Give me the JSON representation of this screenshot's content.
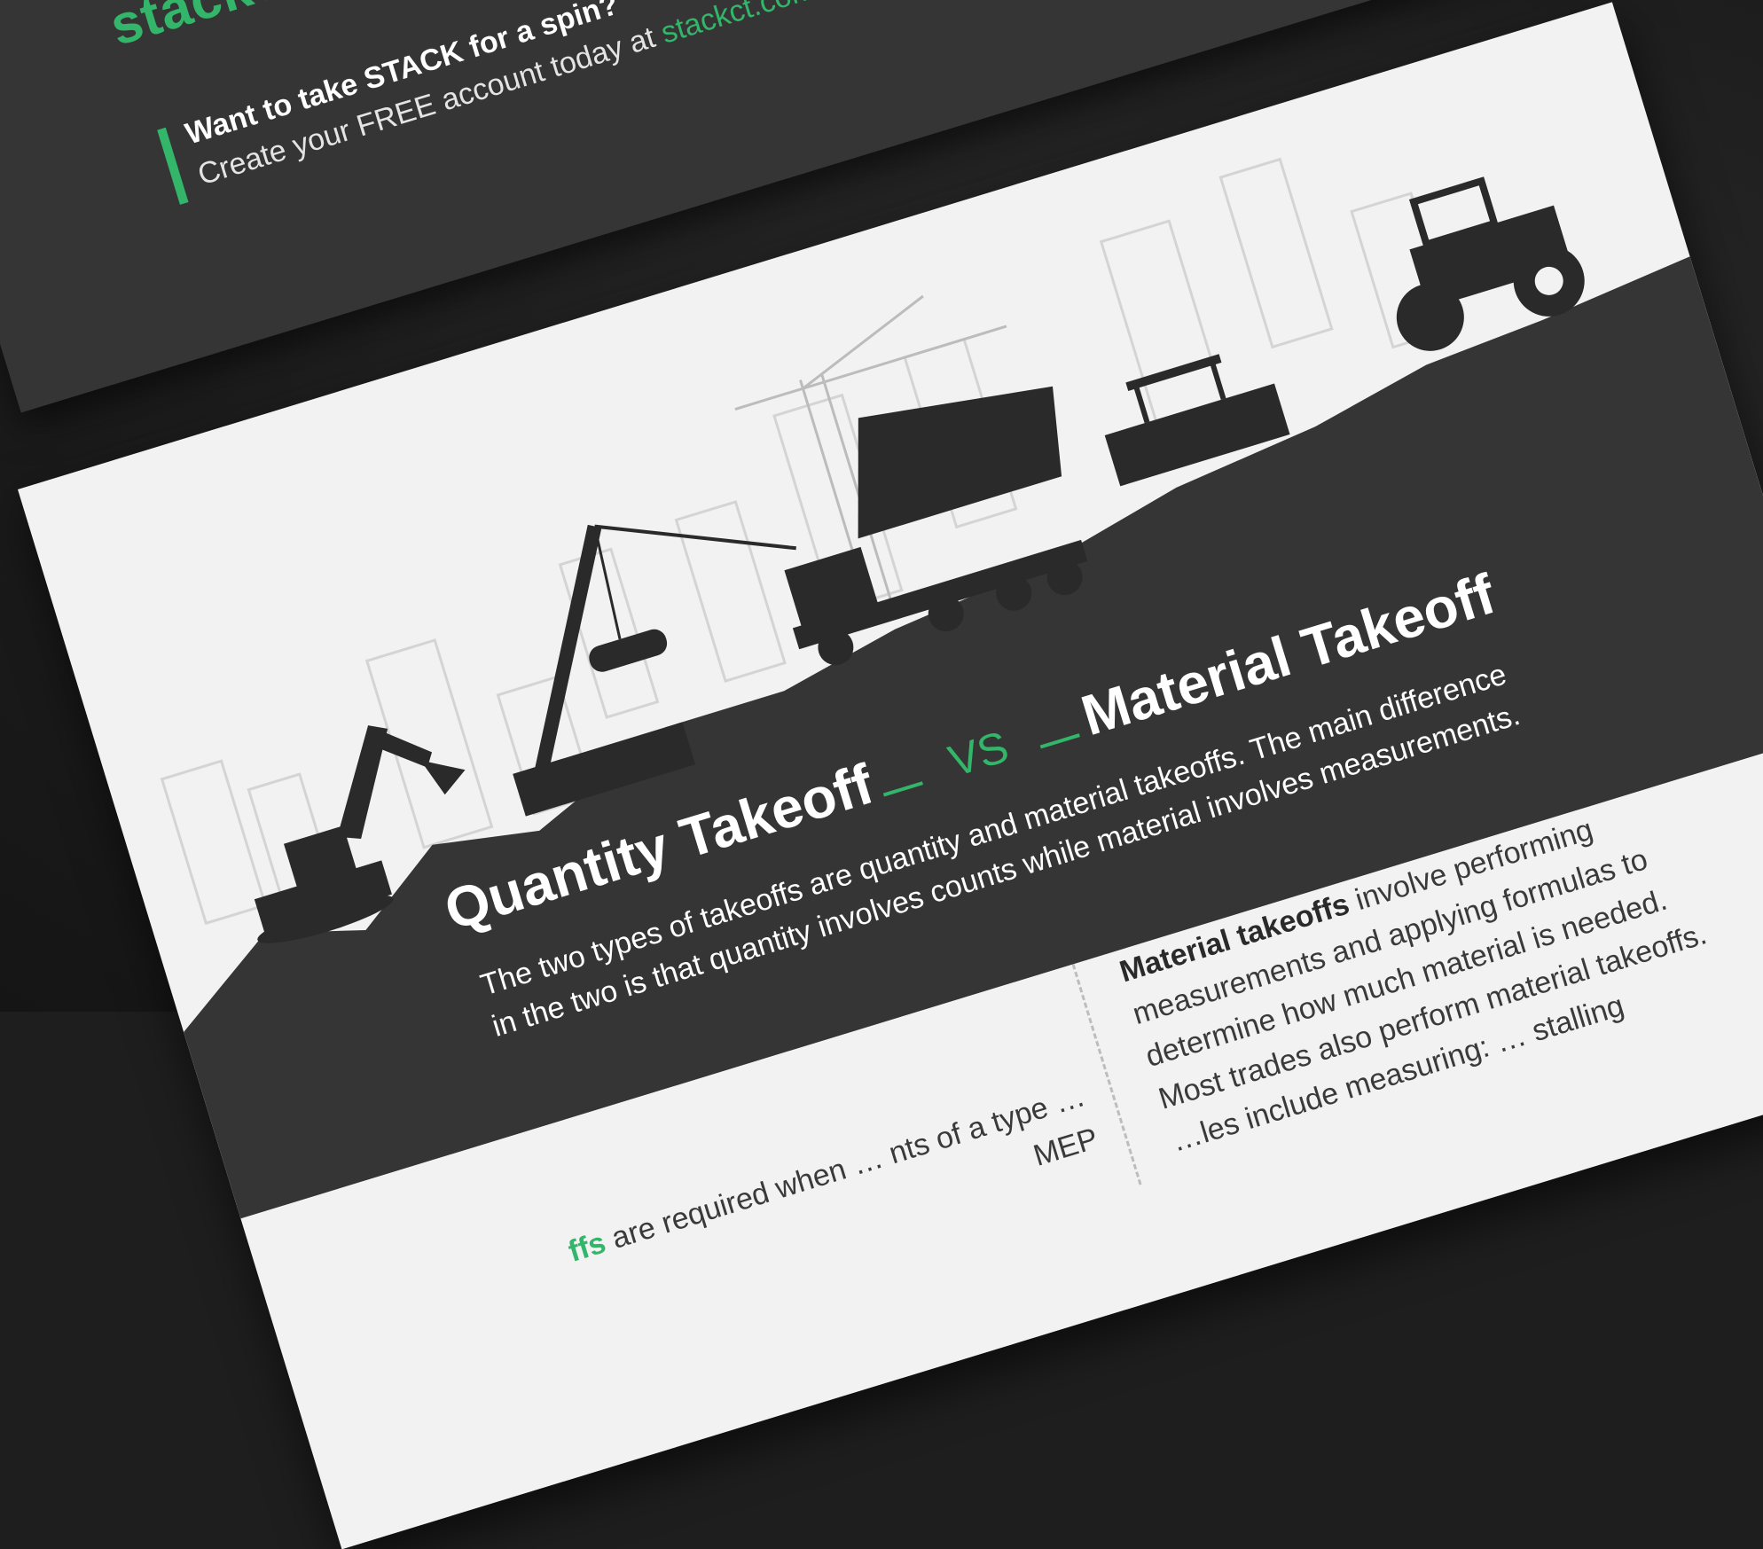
{
  "promo": {
    "brand": "stackct.",
    "title": "Want to take STACK for a spin?",
    "subtitle": "Create your FREE account today at ",
    "link": "stackct.com"
  },
  "infographic": {
    "title_left": "Quantity Takeoff",
    "vs": "VS",
    "title_right": "Material Takeoff",
    "intro": "The two types of takeoffs are quantity and material takeoffs. The main difference in the two is that quantity involves counts while material involves measurements.",
    "left_col": {
      "lead": "ffs",
      "text": " are required when … nts of a type … MEP"
    },
    "right_col": {
      "lead": "Material takeoffs",
      "text": " involve performing measurements and applying formulas to determine how much material is needed. Most trades also perform material takeoffs.",
      "more": "…les include measuring: … stalling"
    }
  },
  "colors": {
    "accent": "#33b56a",
    "dark_band": "#353535",
    "paper": "#f2f2f2"
  },
  "icons": [
    "excavator-icon",
    "crane-icon",
    "pipe-load-icon",
    "dump-truck-icon",
    "paver-icon",
    "road-roller-icon",
    "tower-crane-icon",
    "building-icon"
  ]
}
